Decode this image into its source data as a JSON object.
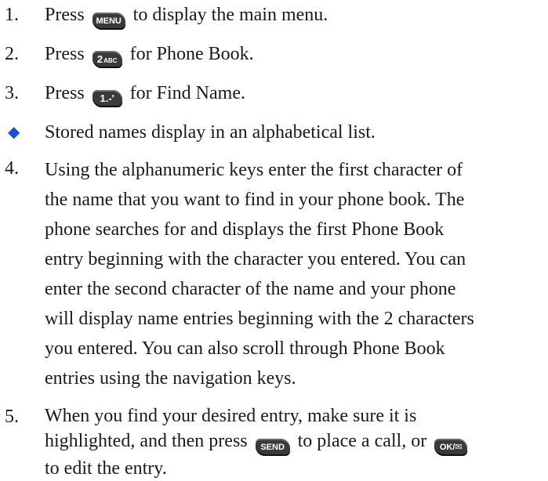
{
  "steps": [
    {
      "num": "1.",
      "pre": "Press",
      "key": "MENU",
      "post": "to display the main menu."
    },
    {
      "num": "2.",
      "pre": "Press",
      "key": "2",
      "key_sub": "ABC",
      "post": "for Phone Book."
    },
    {
      "num": "3.",
      "pre": "Press",
      "key": "1.-'",
      "post": "for Find Name."
    }
  ],
  "bullet": {
    "glyph": "◆",
    "text": "Stored names display in an alphabetical list."
  },
  "step4": {
    "num": "4.",
    "lines": [
      "Using the alphanumeric keys enter the first character of",
      "the name that you want to find in your phone book. The",
      "phone searches for and displays the first Phone Book",
      "entry beginning with the character you entered. You can",
      "enter the second character of the name and your phone",
      "will display name entries beginning with the 2 characters",
      "you entered. You can also scroll through Phone Book",
      "entries using the navigation keys."
    ]
  },
  "step5": {
    "num": "5.",
    "line1": "When you find your desired entry, make sure it is",
    "line2_pre": "highlighted, and then press",
    "send_key": "SEND",
    "line2_mid": "to place a call, or",
    "ok_key": "OK/✉",
    "line3": "to edit the entry."
  },
  "colors": {
    "bullet": "#1f4fd6",
    "key_bg": "#3a3a3a",
    "text": "#1a1a1a"
  }
}
